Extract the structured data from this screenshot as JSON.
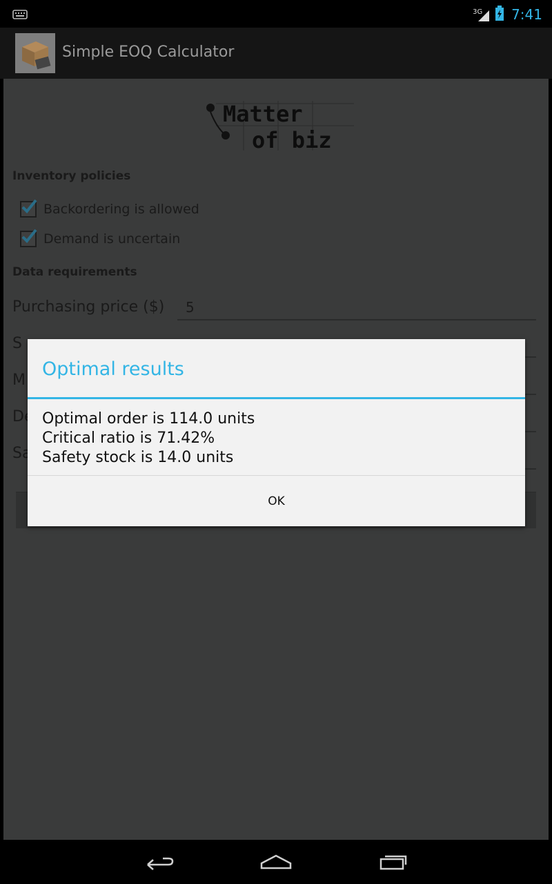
{
  "status_bar": {
    "time": "7:41",
    "network": "3G",
    "icons": [
      "keyboard-icon",
      "signal-icon",
      "battery-icon"
    ]
  },
  "action_bar": {
    "title": "Simple EOQ Calculator",
    "icon": "app-icon"
  },
  "content": {
    "logo_text": [
      "Matter",
      "of biz"
    ],
    "inventory_policies": {
      "header": "Inventory policies",
      "options": [
        {
          "label": "Backordering is allowed",
          "checked": true
        },
        {
          "label": "Demand is uncertain",
          "checked": true
        }
      ]
    },
    "data_requirements": {
      "header": "Data requirements",
      "fields": [
        {
          "label": "Purchasing price ($)",
          "value": "5"
        },
        {
          "label": "S"
        },
        {
          "label": "M"
        },
        {
          "label": "De"
        },
        {
          "label": "Sa"
        }
      ]
    }
  },
  "dialog": {
    "title": "Optimal results",
    "lines": [
      "Optimal order is 114.0 units",
      "Critical ratio is 71.42%",
      "Safety stock is 14.0 units"
    ],
    "ok_label": "OK"
  },
  "nav_bar": {
    "buttons": [
      "back-icon",
      "home-icon",
      "recent-apps-icon"
    ]
  },
  "colors": {
    "accent": "#33b5e5",
    "dim_background": "#3a3b3b",
    "dialog_background": "#f2f2f2"
  }
}
